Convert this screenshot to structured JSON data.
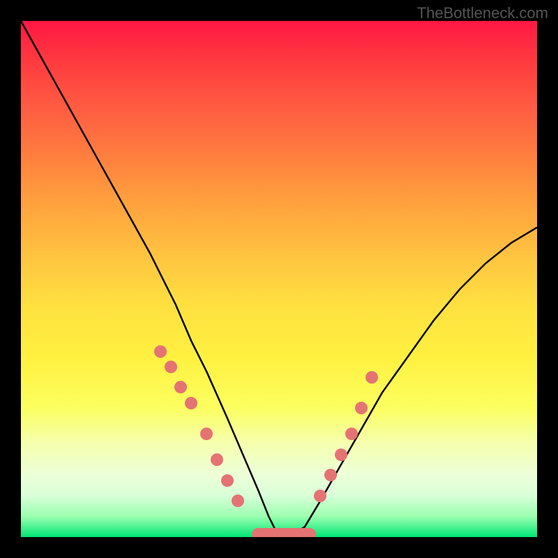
{
  "watermark": "TheBottleneck.com",
  "chart_data": {
    "type": "line",
    "title": "",
    "xlabel": "",
    "ylabel": "",
    "xlim": [
      0,
      100
    ],
    "ylim": [
      0,
      100
    ],
    "grid": false,
    "legend": false,
    "series": [
      {
        "name": "curve",
        "x": [
          0,
          5,
          10,
          15,
          20,
          25,
          30,
          33,
          36,
          40,
          43,
          46,
          48,
          50,
          52,
          55,
          58,
          62,
          66,
          70,
          75,
          80,
          85,
          90,
          95,
          100
        ],
        "y": [
          100,
          91,
          82,
          73,
          64,
          55,
          45,
          38,
          32,
          23,
          16,
          9,
          4,
          0,
          0,
          2,
          7,
          14,
          21,
          28,
          35,
          42,
          48,
          53,
          57,
          60
        ]
      },
      {
        "name": "markers-left",
        "x": [
          27,
          29,
          31,
          33,
          36,
          38,
          40,
          42
        ],
        "y": [
          36,
          33,
          29,
          26,
          20,
          15,
          11,
          7
        ]
      },
      {
        "name": "markers-bottom",
        "x": [
          46,
          48,
          50,
          52,
          54,
          56
        ],
        "y": [
          0,
          0,
          0,
          0,
          0,
          0
        ]
      },
      {
        "name": "markers-right",
        "x": [
          58,
          60,
          62,
          64,
          66,
          68
        ],
        "y": [
          8,
          12,
          16,
          20,
          25,
          31
        ]
      }
    ]
  }
}
